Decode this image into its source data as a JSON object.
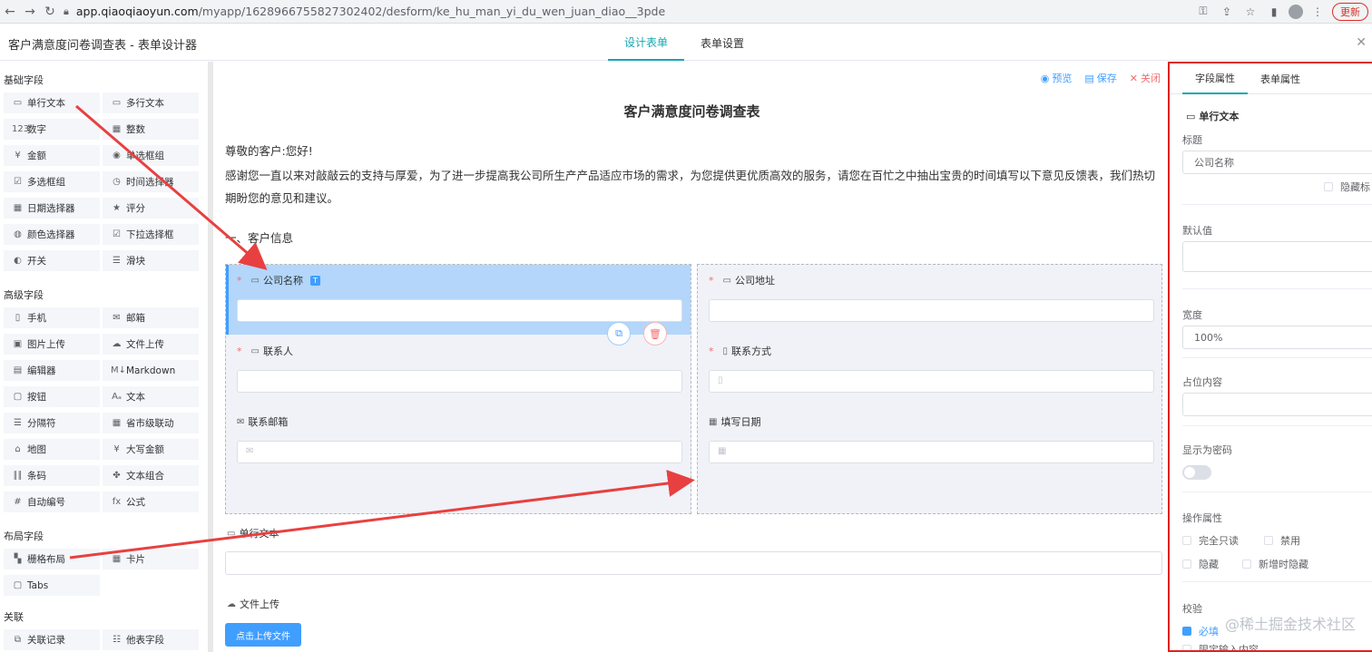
{
  "browser": {
    "url_host": "app.qiaoqiaoyun.com",
    "url_path": "/myapp/1628966755827302402/desform/ke_hu_man_yi_du_wen_juan_diao__3pde",
    "update_label": "更新"
  },
  "header": {
    "title": "客户满意度问卷调查表 - 表单设计器",
    "tabs": [
      {
        "label": "设计表单",
        "active": true
      },
      {
        "label": "表单设置",
        "active": false
      }
    ]
  },
  "left_panel": {
    "groups": [
      {
        "title": "基础字段",
        "items": [
          {
            "label": "单行文本",
            "icon": "input-icon"
          },
          {
            "label": "多行文本",
            "icon": "textarea-icon"
          },
          {
            "label": "数字",
            "icon": "number-icon"
          },
          {
            "label": "整数",
            "icon": "integer-icon"
          },
          {
            "label": "金额",
            "icon": "money-icon"
          },
          {
            "label": "单选框组",
            "icon": "radio-icon"
          },
          {
            "label": "多选框组",
            "icon": "checkbox-icon"
          },
          {
            "label": "时间选择器",
            "icon": "clock-icon"
          },
          {
            "label": "日期选择器",
            "icon": "calendar-icon"
          },
          {
            "label": "评分",
            "icon": "star-icon"
          },
          {
            "label": "颜色选择器",
            "icon": "palette-icon"
          },
          {
            "label": "下拉选择框",
            "icon": "select-icon"
          },
          {
            "label": "开关",
            "icon": "switch-icon"
          },
          {
            "label": "滑块",
            "icon": "slider-icon"
          }
        ]
      },
      {
        "title": "高级字段",
        "items": [
          {
            "label": "手机",
            "icon": "phone-icon"
          },
          {
            "label": "邮箱",
            "icon": "mail-icon"
          },
          {
            "label": "图片上传",
            "icon": "image-icon"
          },
          {
            "label": "文件上传",
            "icon": "cloud-upload-icon"
          },
          {
            "label": "编辑器",
            "icon": "editor-icon"
          },
          {
            "label": "Markdown",
            "icon": "markdown-icon"
          },
          {
            "label": "按钮",
            "icon": "button-icon"
          },
          {
            "label": "文本",
            "icon": "text-icon"
          },
          {
            "label": "分隔符",
            "icon": "divider-icon"
          },
          {
            "label": "省市级联动",
            "icon": "region-icon"
          },
          {
            "label": "地图",
            "icon": "map-icon"
          },
          {
            "label": "大写金额",
            "icon": "uppercase-money-icon"
          },
          {
            "label": "条码",
            "icon": "barcode-icon"
          },
          {
            "label": "文本组合",
            "icon": "group-icon"
          },
          {
            "label": "自动编号",
            "icon": "hash-icon"
          },
          {
            "label": "公式",
            "icon": "formula-icon"
          }
        ]
      },
      {
        "title": "布局字段",
        "items": [
          {
            "label": "栅格布局",
            "icon": "grid-icon"
          },
          {
            "label": "卡片",
            "icon": "card-icon"
          },
          {
            "label": "Tabs",
            "icon": "tabs-icon"
          }
        ]
      },
      {
        "title": "关联",
        "items": [
          {
            "label": "关联记录",
            "icon": "link-record-icon"
          },
          {
            "label": "他表字段",
            "icon": "other-field-icon"
          }
        ]
      }
    ]
  },
  "canvas": {
    "toolbar": {
      "preview": "预览",
      "save": "保存",
      "close": "关闭"
    },
    "form_title": "客户满意度问卷调查表",
    "greeting": "尊敬的客户:您好!",
    "intro": "感谢您一直以来对敲敲云的支持与厚爱，为了进一步提高我公司所生产产品适应市场的需求，为您提供更优质高效的服务，请您在百忙之中抽出宝贵的时间填写以下意见反馈表，我们热切期盼您的意见和建议。",
    "section_heading": "一、客户信息",
    "fields_left": [
      {
        "label": "公司名称",
        "required": true,
        "tag": "T"
      },
      {
        "label": "联系人",
        "required": true
      },
      {
        "label": "联系邮箱",
        "required": false
      }
    ],
    "fields_right": [
      {
        "label": "公司地址",
        "required": true
      },
      {
        "label": "联系方式",
        "required": true
      },
      {
        "label": "填写日期",
        "required": false
      }
    ],
    "single_text_label": "单行文本",
    "file_upload_label": "文件上传",
    "upload_button": "点击上传文件"
  },
  "right_panel": {
    "tabs": [
      {
        "label": "字段属性",
        "active": true
      },
      {
        "label": "表单属性",
        "active": false
      }
    ],
    "field_type": "单行文本",
    "title_label": "标题",
    "title_value": "公司名称",
    "hide_title": "隐藏标",
    "default_label": "默认值",
    "width_label": "宽度",
    "width_value": "100%",
    "placeholder_label": "占位内容",
    "password_label": "显示为密码",
    "ops_label": "操作属性",
    "ops": {
      "readonly": "完全只读",
      "disabled": "禁用",
      "hidden": "隐藏",
      "hide_on_add": "新增时隐藏"
    },
    "validate_label": "校验",
    "validate_required": "必填",
    "limit_label": "限定输入内容"
  },
  "watermark": "@稀土掘金技术社区",
  "colors": {
    "accent": "#16a7b2",
    "primary": "#409eff",
    "danger": "#f56c6c",
    "annotation": "#e02020"
  }
}
